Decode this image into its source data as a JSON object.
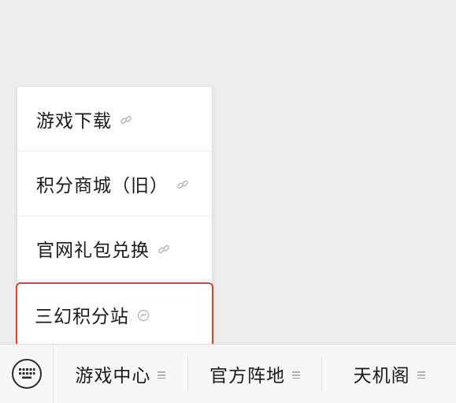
{
  "popup_menu": {
    "items": [
      {
        "label": "游戏下载",
        "icon": "link-icon"
      },
      {
        "label": "积分商城（旧）",
        "icon": "link-icon"
      },
      {
        "label": "官网礼包兑换",
        "icon": "link-icon"
      },
      {
        "label": "三幻积分站",
        "icon": "mini-program-icon",
        "highlight_color": "#d9432f"
      }
    ]
  },
  "bottom_bar": {
    "keyboard_icon": "keyboard-icon",
    "tabs": [
      {
        "label": "游戏中心",
        "icon": "menu-lines-icon"
      },
      {
        "label": "官方阵地",
        "icon": "menu-lines-icon"
      },
      {
        "label": "天机阁",
        "icon": "menu-lines-icon"
      }
    ]
  }
}
